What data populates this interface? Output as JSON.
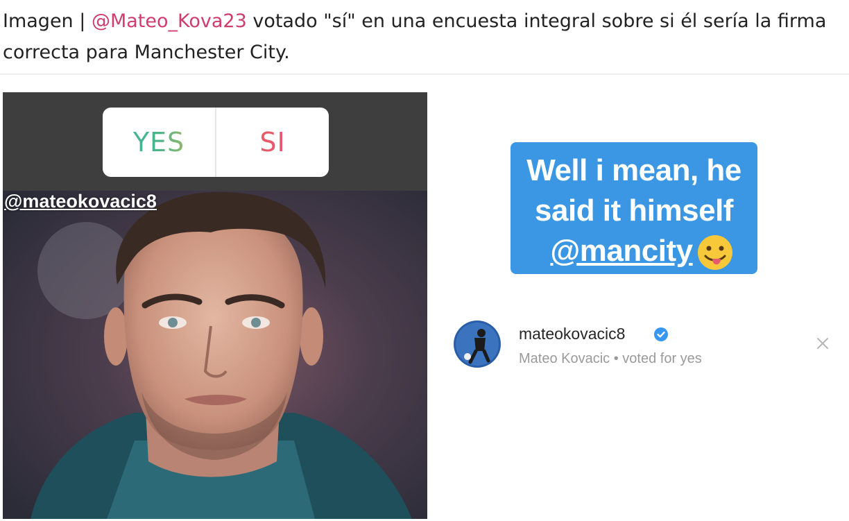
{
  "caption": {
    "prefix": "Imagen | ",
    "mention": "@Mateo_Kova23",
    "rest": " votado \"sí\" en una encuesta integral sobre si él sería la firma correcta para Manchester City."
  },
  "story": {
    "poll": {
      "option_yes": "YES",
      "option_si": "SI"
    },
    "handle": "@mateokovacic8"
  },
  "quote": {
    "line1": "Well i mean, he",
    "line2": "said it himself",
    "mention": "@mancity",
    "emoji": "tongue-out-face",
    "bg_color": "#3b97e3"
  },
  "voter": {
    "username": "mateokovacic8",
    "subtitle": "Mateo Kovacic • voted for yes",
    "verified_color": "#3897f0"
  },
  "icons": {
    "close": "close-icon"
  }
}
